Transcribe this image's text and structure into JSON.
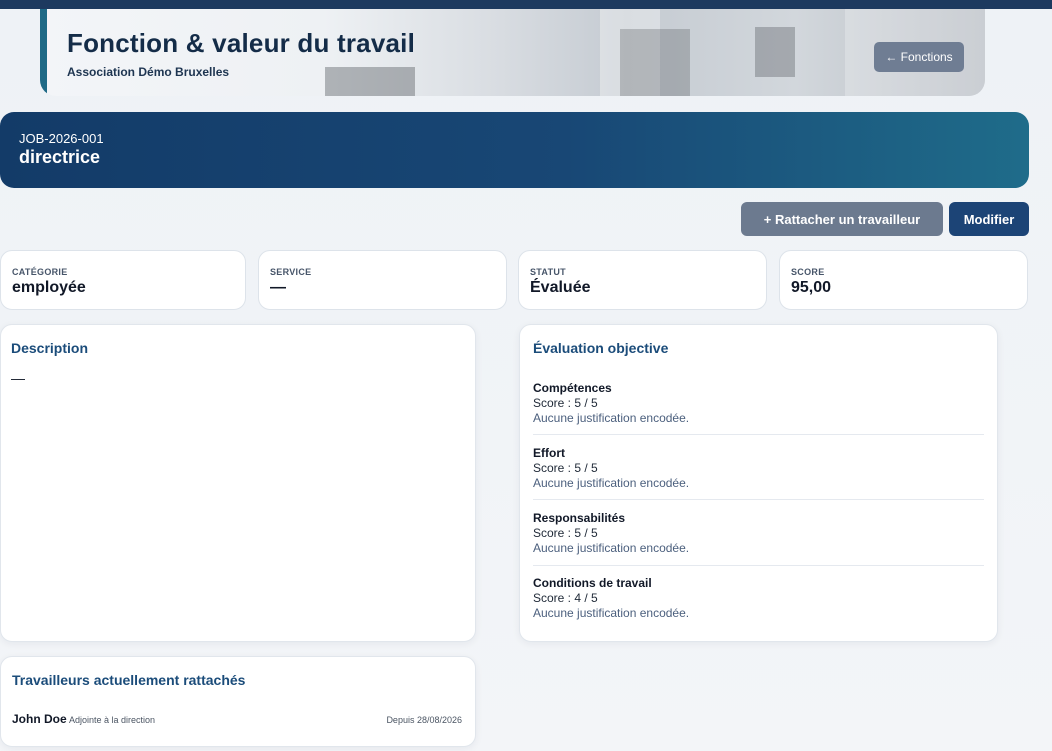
{
  "header": {
    "title": "Fonction & valeur du travail",
    "organization": "Association Démo Bruxelles",
    "back_button_label": "← Fonctions"
  },
  "job": {
    "code": "JOB-2026-001",
    "name": "directrice"
  },
  "actions": {
    "attach_worker_label": "+ Rattacher un travailleur",
    "edit_label": "Modifier"
  },
  "stats": [
    {
      "label": "CATÉGORIE",
      "value": "employée"
    },
    {
      "label": "SERVICE",
      "value": "—"
    },
    {
      "label": "STATUT",
      "value": "Évaluée"
    },
    {
      "label": "SCORE",
      "value": "95,00"
    }
  ],
  "description": {
    "title": "Description",
    "text": "—"
  },
  "evaluation": {
    "title": "Évaluation objective",
    "criteria": [
      {
        "name": "Compétences",
        "score": "Score : 5 / 5",
        "justification": "Aucune justification encodée."
      },
      {
        "name": "Effort",
        "score": "Score : 5 / 5",
        "justification": "Aucune justification encodée."
      },
      {
        "name": "Responsabilités",
        "score": "Score : 5 / 5",
        "justification": "Aucune justification encodée."
      },
      {
        "name": "Conditions de travail",
        "score": "Score : 4 / 5",
        "justification": "Aucune justification encodée."
      }
    ]
  },
  "workers": {
    "title": "Travailleurs actuellement rattachés",
    "items": [
      {
        "name": "John Doe",
        "role": "Adjointe à la direction",
        "since": "Depuis 28/08/2026"
      }
    ]
  },
  "colors": {
    "primary": "#1c4476",
    "banner_start": "#133b68",
    "banner_end": "#1f6c8a",
    "secondary_button": "#6c7a8f",
    "heading": "#1b4c7a"
  }
}
